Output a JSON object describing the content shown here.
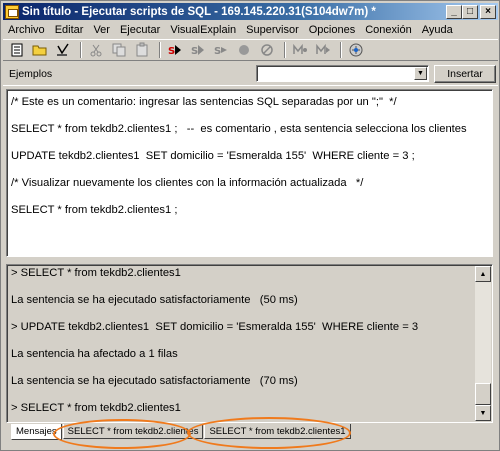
{
  "window": {
    "title": "Sin título - Ejecutar scripts de SQL - 169.145.220.31(S104dw7m) *",
    "controls": [
      "_",
      "□",
      "×"
    ]
  },
  "menu": [
    "Archivo",
    "Editar",
    "Ver",
    "Ejecutar",
    "VisualExplain",
    "Supervisor",
    "Opciones",
    "Conexión",
    "Ayuda"
  ],
  "examples": {
    "label": "Ejemplos",
    "selected": "",
    "insert_label": "Insertar"
  },
  "editor": {
    "lines": [
      "/* Este es un comentario: ingresar las sentencias SQL separadas por un \";\"  */",
      "SELECT * from tekdb2.clientes1 ;   --  es comentario , esta sentencia selecciona los clientes",
      "UPDATE tekdb2.clientes1  SET domicilio = 'Esmeralda 155'  WHERE cliente = 3 ;",
      "/* Visualizar nuevamente los clientes con la información actualizada   */",
      "SELECT * from tekdb2.clientes1 ;"
    ]
  },
  "results": {
    "lines": [
      "> SELECT * from tekdb2.clientes1",
      "La sentencia se ha ejecutado satisfactoriamente   (50 ms)",
      "> UPDATE tekdb2.clientes1  SET domicilio = 'Esmeralda 155'  WHERE cliente = 3",
      "La sentencia ha afectado a 1 filas",
      "La sentencia se ha ejecutado satisfactoriamente   (70 ms)",
      "> SELECT * from tekdb2.clientes1"
    ]
  },
  "tabs": [
    "Mensajes",
    "SELECT * from tekdb2.clientes",
    "SELECT * from tekdb2.clientes1"
  ],
  "colors": {
    "titlebar_start": "#0a246a",
    "highlight_ring": "#f07a1c"
  }
}
